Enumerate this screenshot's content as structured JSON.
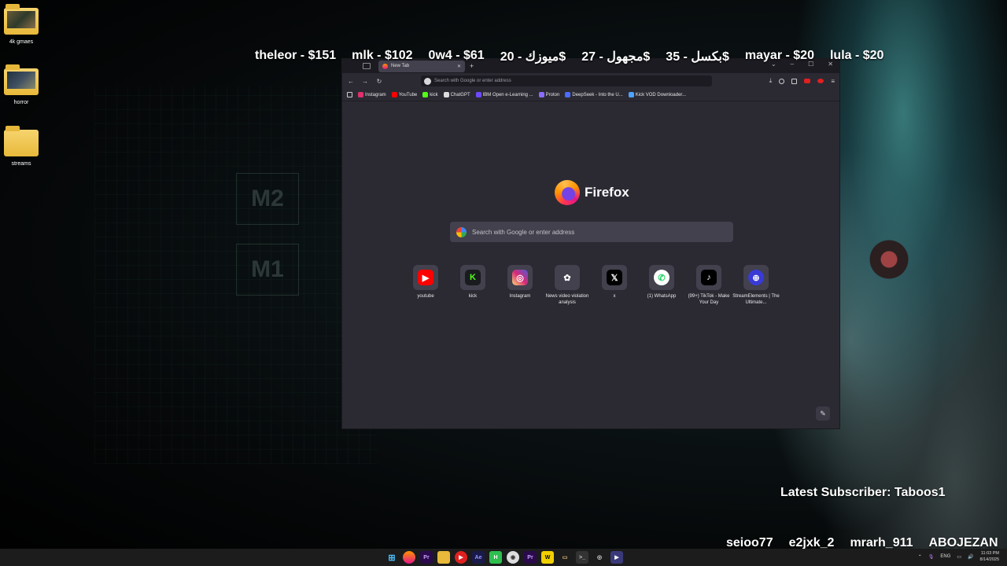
{
  "desktop": {
    "icons": [
      {
        "label": "4k gmaes"
      },
      {
        "label": "horror"
      },
      {
        "label": "streams"
      }
    ]
  },
  "donations": [
    "theleor - $151",
    "mlk - $102",
    "0w4 - $61",
    "ميوزك - 20$",
    "مجهول - 27$",
    "بكسل - 35$",
    "mayar - $20",
    "lula - $20"
  ],
  "browser": {
    "tab_title": "New Tab",
    "url_placeholder": "Search with Google or enter address",
    "bookmarks": [
      "Instagram",
      "YouTube",
      "kick",
      "ChatGPT",
      "IBM Open e-Learning ...",
      "Proton",
      "DeepSeek - Into the U...",
      "Kick VOD Downloader..."
    ],
    "brand": "Firefox",
    "search_placeholder": "Search with Google or enter address",
    "tiles": [
      {
        "label": "youtube",
        "icon": "youtube-icon",
        "color": "#ff0000"
      },
      {
        "label": "kick",
        "icon": "kick-icon",
        "color": "#53fc18"
      },
      {
        "label": "Instagram",
        "icon": "instagram-icon",
        "color": "#e1306c"
      },
      {
        "label": "News video violation analysis",
        "icon": "chatgpt-icon",
        "color": "#ffffff"
      },
      {
        "label": "x",
        "icon": "x-icon",
        "color": "#000000"
      },
      {
        "label": "(1) WhatsApp",
        "icon": "whatsapp-icon",
        "color": "#25d366"
      },
      {
        "label": "(99+) TikTok - Make Your Day",
        "icon": "tiktok-icon",
        "color": "#000000"
      },
      {
        "label": "StreamElements | The Ultimate...",
        "icon": "streamelements-icon",
        "color": "#3a3ad6"
      }
    ]
  },
  "overlay": {
    "latest_subscriber": "Latest Subscriber: Taboos1",
    "subs": [
      "seioo77",
      "e2jxk_2",
      "mrarh_911",
      "ABOJEZAN"
    ]
  },
  "taskbar": {
    "lang": "ENG",
    "time": "11:03 PM",
    "date": "8/14/2025"
  }
}
